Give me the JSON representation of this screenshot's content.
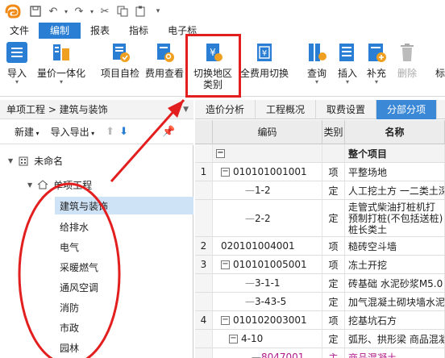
{
  "menubar": {
    "items": [
      "文件",
      "编制",
      "报表",
      "指标",
      "电子标"
    ],
    "active_index": 1
  },
  "ribbon": {
    "buttons": [
      {
        "label": "导入",
        "has_dropdown": true
      },
      {
        "label": "量价一体化",
        "has_dropdown": true
      },
      {
        "label": "项目自检",
        "has_dropdown": false
      },
      {
        "label": "费用查看",
        "has_dropdown": false
      },
      {
        "label": "切换地区\n类别",
        "has_dropdown": false
      },
      {
        "label": "全费用切换",
        "has_dropdown": false
      },
      {
        "label": "查询",
        "has_dropdown": true
      },
      {
        "label": "插入",
        "has_dropdown": true
      },
      {
        "label": "补充",
        "has_dropdown": true
      },
      {
        "label": "删除",
        "has_dropdown": false
      },
      {
        "label": "标",
        "has_dropdown": false
      }
    ]
  },
  "left": {
    "breadcrumb": "单项工程 > 建筑与装饰",
    "toolbar": {
      "new": "新建",
      "import_export": "导入导出"
    },
    "tree": {
      "root": "未命名",
      "project": "单项工程",
      "items": [
        "建筑与装饰",
        "给排水",
        "电气",
        "采暖燃气",
        "通风空调",
        "消防",
        "市政",
        "园林"
      ],
      "selected_index": 0
    }
  },
  "tabs": [
    "造价分析",
    "工程概况",
    "取费设置",
    "分部分项"
  ],
  "active_tab": 3,
  "grid": {
    "headers": {
      "code": "编码",
      "type": "类别",
      "name": "名称"
    },
    "rows": [
      {
        "num": "",
        "code": "",
        "type": "",
        "name": "整个项目",
        "bold": true,
        "level": 0,
        "box": "−",
        "color": "#222"
      },
      {
        "num": "1",
        "code": "010101001001",
        "type": "项",
        "name": "平整场地",
        "bold": false,
        "level": 1,
        "box": "−",
        "color": "#222"
      },
      {
        "num": "",
        "code": "1-2",
        "type": "定",
        "name": "人工挖土方 一二类土深",
        "bold": false,
        "level": 2,
        "box": "",
        "color": "#222"
      },
      {
        "num": "",
        "code": "2-2",
        "type": "定",
        "name": "走管式柴油打桩机打预制打桩(不包括送桩) 桩长类土",
        "bold": false,
        "level": 2,
        "box": "",
        "color": "#222",
        "tall": true
      },
      {
        "num": "2",
        "code": "020101004001",
        "type": "项",
        "name": "糙砖空斗墙",
        "bold": false,
        "level": 1,
        "box": "",
        "color": "#222"
      },
      {
        "num": "3",
        "code": "010101005001",
        "type": "项",
        "name": "冻土开挖",
        "bold": false,
        "level": 1,
        "box": "−",
        "color": "#222"
      },
      {
        "num": "",
        "code": "3-1-1",
        "type": "定",
        "name": "砖基础 水泥砂浆M5.0",
        "bold": false,
        "level": 2,
        "box": "",
        "color": "#222"
      },
      {
        "num": "",
        "code": "3-43-5",
        "type": "定",
        "name": "加气混凝土砌块墙水泥砂",
        "bold": false,
        "level": 2,
        "box": "",
        "color": "#222"
      },
      {
        "num": "4",
        "code": "010102003001",
        "type": "项",
        "name": "挖基坑石方",
        "bold": false,
        "level": 1,
        "box": "−",
        "color": "#222"
      },
      {
        "num": "",
        "code": "4-10",
        "type": "定",
        "name": "弧形、拱形梁 商品混凝",
        "bold": false,
        "level": 2,
        "box": "−",
        "color": "#222"
      },
      {
        "num": "",
        "code": "8047001",
        "type": "主",
        "name": "商品混凝土",
        "bold": false,
        "level": 3,
        "box": "",
        "color": "#b0188a"
      }
    ]
  },
  "colors": {
    "accent": "#2a7fd4",
    "selected": "#cfe3f7",
    "annotation": "#e31e1e"
  }
}
